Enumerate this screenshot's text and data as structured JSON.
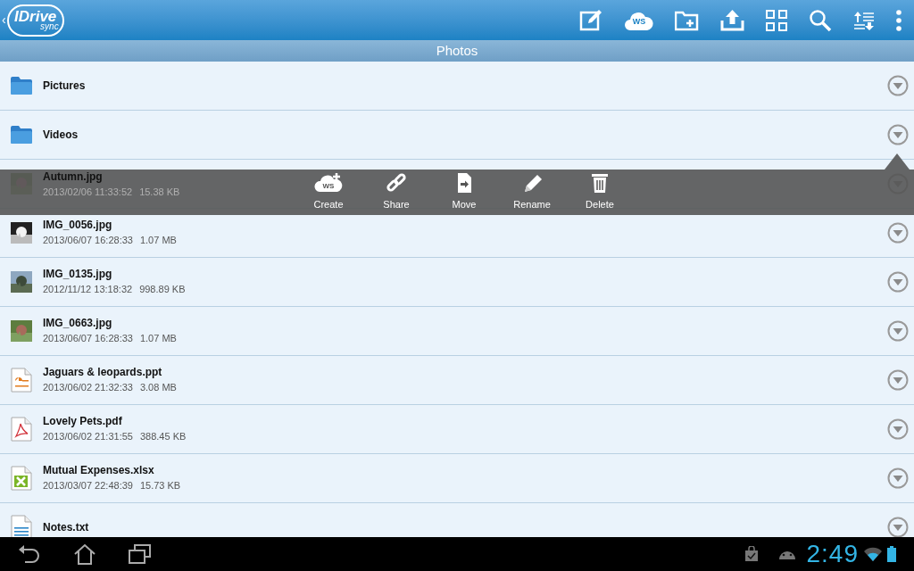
{
  "app_bar": {
    "back": "‹",
    "logo_text": "IDrive",
    "logo_sub": "sync"
  },
  "title": "Photos",
  "files": [
    {
      "kind": "folder",
      "name": "Pictures",
      "actions_open": false
    },
    {
      "kind": "folder",
      "name": "Videos",
      "actions_open": false
    },
    {
      "name": "Autumn.jpg",
      "date": "2013/02/06 11:33:52",
      "size": "15.38 KB",
      "actions_open": true
    },
    {
      "name": "IMG_0056.jpg",
      "date": "2013/06/07 16:28:33",
      "size": "1.07 MB",
      "actions_open": false
    },
    {
      "name": "IMG_0135.jpg",
      "date": "2012/11/12 13:18:32",
      "size": "998.89 KB",
      "actions_open": false
    },
    {
      "name": "IMG_0663.jpg",
      "date": "2013/06/07 16:28:33",
      "size": "1.07 MB",
      "actions_open": false
    },
    {
      "kind": "ppt",
      "name": "Jaguars & leopards.ppt",
      "date": "2013/06/02 21:32:33",
      "size": "3.08 MB",
      "actions_open": false
    },
    {
      "kind": "pdf",
      "name": "Lovely Pets.pdf",
      "date": "2013/06/02 21:31:55",
      "size": "388.45 KB",
      "actions_open": false
    },
    {
      "kind": "xlsx",
      "name": "Mutual Expenses.xlsx",
      "date": "2013/03/07 22:48:39",
      "size": "15.73 KB",
      "actions_open": false
    },
    {
      "kind": "txt",
      "name": "Notes.txt",
      "actions_open": false
    }
  ],
  "actions": [
    {
      "kind": "create",
      "label": "Create",
      "badge": "WS"
    },
    {
      "kind": "share",
      "label": "Share"
    },
    {
      "kind": "move",
      "label": "Move"
    },
    {
      "kind": "rename",
      "label": "Rename"
    },
    {
      "kind": "delete",
      "label": "Delete"
    }
  ],
  "toolbar_badge": "WS",
  "status_bar": {
    "time": "2:49"
  }
}
